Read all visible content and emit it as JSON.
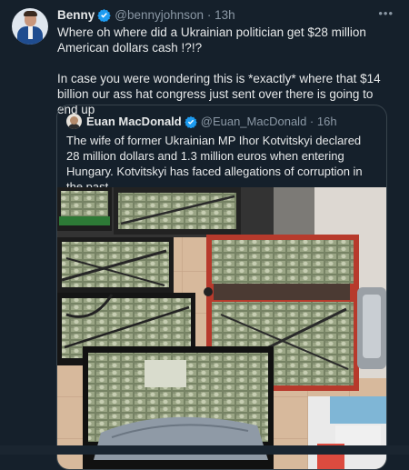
{
  "tweet": {
    "author_name": "Benny",
    "author_handle": "@bennyjohnson",
    "separator": "·",
    "time": "13h",
    "text_line1": "Where oh where did a Ukrainian politician get $28 million American dollars cash !?!?",
    "text_line2": "In case you were wondering this is *exactly* where that $14 billion our ass hat congress just sent over there is going to end up"
  },
  "quoted": {
    "author_name": "Euan MacDonald",
    "author_handle": "@Euan_MacDonald",
    "separator": "·",
    "time": "16h",
    "text": "The wife of former Ukrainian MP Ihor Kotvitskyi declared 28 million dollars and 1.3 million euros when entering Hungary. Kotvitskyi has faced allegations of corruption in the past."
  },
  "colors": {
    "background": "#15202b",
    "text": "#e7e9ea",
    "secondary": "#8b98a5",
    "verified": "#1d9bf0",
    "border": "#38444d"
  },
  "icons": [
    "verified-badge-icon",
    "more-options-icon"
  ]
}
